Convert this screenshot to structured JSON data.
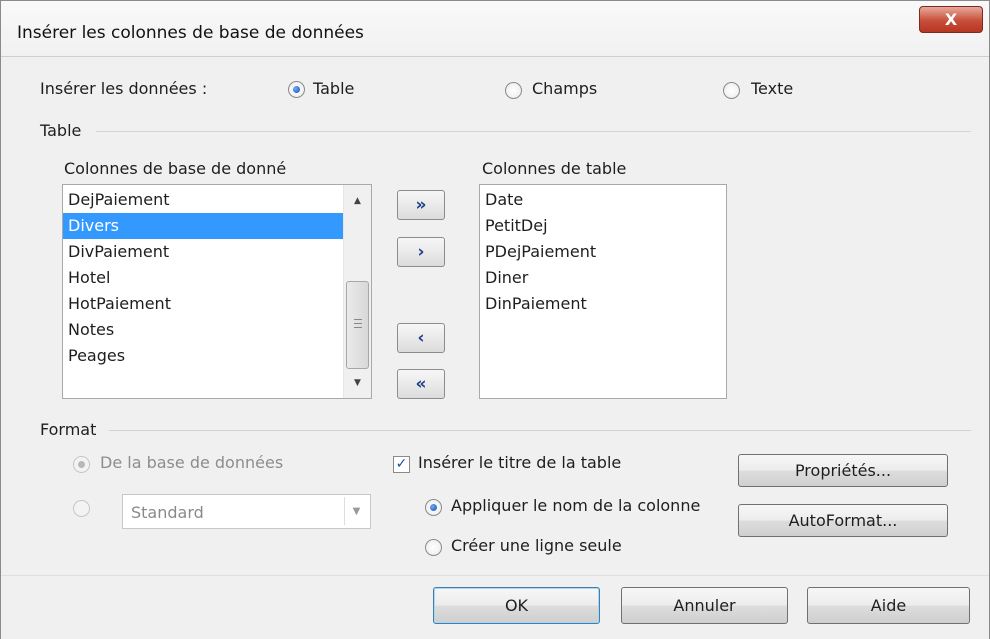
{
  "window": {
    "title": "Insérer les colonnes de base de données",
    "close_label": "X"
  },
  "insert": {
    "label": "Insérer les données :",
    "options": [
      {
        "label": "Table",
        "checked": true
      },
      {
        "label": "Champs",
        "checked": false
      },
      {
        "label": "Texte",
        "checked": false
      }
    ]
  },
  "table_section": {
    "title": "Table",
    "db_columns_label": "Colonnes de base de donné",
    "db_columns": [
      "DejPaiement",
      "Divers",
      "DivPaiement",
      "Hotel",
      "HotPaiement",
      "Notes",
      "Peages"
    ],
    "db_selected": "Divers",
    "table_columns_label": "Colonnes de table",
    "table_columns": [
      "Date",
      "PetitDej",
      "PDejPaiement",
      "Diner",
      "DinPaiement"
    ],
    "move_all_right": "»",
    "move_right": "›",
    "move_left": "‹",
    "move_all_left": "«",
    "scroll_up": "▲",
    "scroll_down": "▼"
  },
  "format_section": {
    "title": "Format",
    "from_db_label": "De la base de données",
    "from_db_checked": true,
    "custom_checked": false,
    "format_combo": "Standard",
    "combo_arrow": "▼",
    "insert_title_label": "Insérer le titre de la table",
    "insert_title_checked": true,
    "checkmark": "✓",
    "apply_column_name_label": "Appliquer le nom de la colonne",
    "apply_column_name_checked": true,
    "single_line_label": "Créer une ligne seule",
    "single_line_checked": false,
    "properties_label": "Propriétés...",
    "autoformat_label": "AutoFormat..."
  },
  "footer": {
    "ok": "OK",
    "cancel": "Annuler",
    "help": "Aide"
  }
}
